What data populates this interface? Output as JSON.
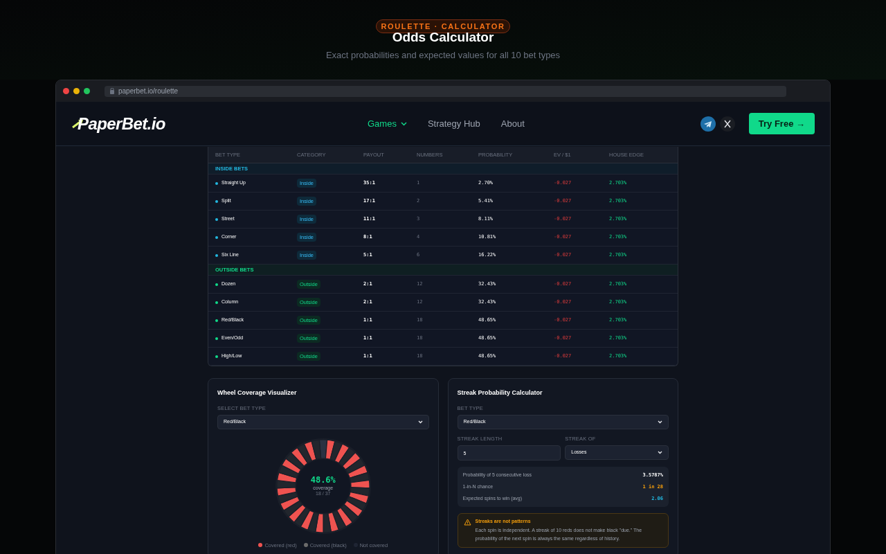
{
  "hero": {
    "eyebrow": "ROULETTE · CALCULATOR",
    "title": "Odds Calculator",
    "subtitle": "Exact probabilities and expected values for all 10 bet types"
  },
  "browser": {
    "url": "paperbet.io/roulette"
  },
  "nav": {
    "logo": "PaperBet.io",
    "links": [
      {
        "label": "Games",
        "selected": true,
        "dropdown": true
      },
      {
        "label": "Strategy Hub",
        "selected": false,
        "dropdown": false
      },
      {
        "label": "About",
        "selected": false,
        "dropdown": false
      }
    ],
    "cta": "Try Free →"
  },
  "table": {
    "columns": [
      "BET TYPE",
      "CATEGORY",
      "PAYOUT",
      "NUMBERS",
      "PROBABILITY",
      "EV / $1",
      "HOUSE EDGE"
    ],
    "sections": [
      {
        "title": "INSIDE BETS",
        "kind": "inside",
        "rows": [
          {
            "bet": "Straight Up",
            "category": "Inside",
            "payout": "35:1",
            "numbers": "1",
            "probability": "2.70%",
            "ev": "-0.027",
            "edge": "2.703%"
          },
          {
            "bet": "Split",
            "category": "Inside",
            "payout": "17:1",
            "numbers": "2",
            "probability": "5.41%",
            "ev": "-0.027",
            "edge": "2.703%"
          },
          {
            "bet": "Street",
            "category": "Inside",
            "payout": "11:1",
            "numbers": "3",
            "probability": "8.11%",
            "ev": "-0.027",
            "edge": "2.703%"
          },
          {
            "bet": "Corner",
            "category": "Inside",
            "payout": "8:1",
            "numbers": "4",
            "probability": "10.81%",
            "ev": "-0.027",
            "edge": "2.703%"
          },
          {
            "bet": "Six Line",
            "category": "Inside",
            "payout": "5:1",
            "numbers": "6",
            "probability": "16.22%",
            "ev": "-0.027",
            "edge": "2.703%"
          }
        ]
      },
      {
        "title": "OUTSIDE BETS",
        "kind": "outside",
        "rows": [
          {
            "bet": "Dozen",
            "category": "Outside",
            "payout": "2:1",
            "numbers": "12",
            "probability": "32.43%",
            "ev": "-0.027",
            "edge": "2.703%"
          },
          {
            "bet": "Column",
            "category": "Outside",
            "payout": "2:1",
            "numbers": "12",
            "probability": "32.43%",
            "ev": "-0.027",
            "edge": "2.703%"
          },
          {
            "bet": "Red/Black",
            "category": "Outside",
            "payout": "1:1",
            "numbers": "18",
            "probability": "48.65%",
            "ev": "-0.027",
            "edge": "2.703%"
          },
          {
            "bet": "Even/Odd",
            "category": "Outside",
            "payout": "1:1",
            "numbers": "18",
            "probability": "48.65%",
            "ev": "-0.027",
            "edge": "2.703%"
          },
          {
            "bet": "High/Low",
            "category": "Outside",
            "payout": "1:1",
            "numbers": "18",
            "probability": "48.65%",
            "ev": "-0.027",
            "edge": "2.703%"
          }
        ]
      }
    ]
  },
  "wheel_card": {
    "title": "Wheel Coverage Visualizer",
    "select_label": "SELECT BET TYPE",
    "select_value": "Red/Black",
    "coverage": "48.6%",
    "coverage_label": "coverage",
    "coverage_count": "18 / 37",
    "legend": [
      "Covered (red)",
      "Covered (black)",
      "Not covered"
    ]
  },
  "streak_card": {
    "title": "Streak Probability Calculator",
    "bet_label": "BET TYPE",
    "bet_value": "Red/Black",
    "length_label": "STREAK LENGTH",
    "length_value": "5",
    "of_label": "STREAK OF",
    "of_value": "Losses",
    "results": [
      {
        "label": "Probability of 5 consecutive loss",
        "value": "3.5787%",
        "kind": "plain"
      },
      {
        "label": "1-in-N chance",
        "value": "1 in 28",
        "kind": "warn"
      },
      {
        "label": "Expected spins to win (avg)",
        "value": "2.06",
        "kind": "info"
      }
    ],
    "warning": {
      "title": "Streaks are not patterns",
      "text": "Each spin is independent. A streak of 10 reds does not make black \"due.\" The probability of the next spin is always the same regardless of history."
    }
  }
}
